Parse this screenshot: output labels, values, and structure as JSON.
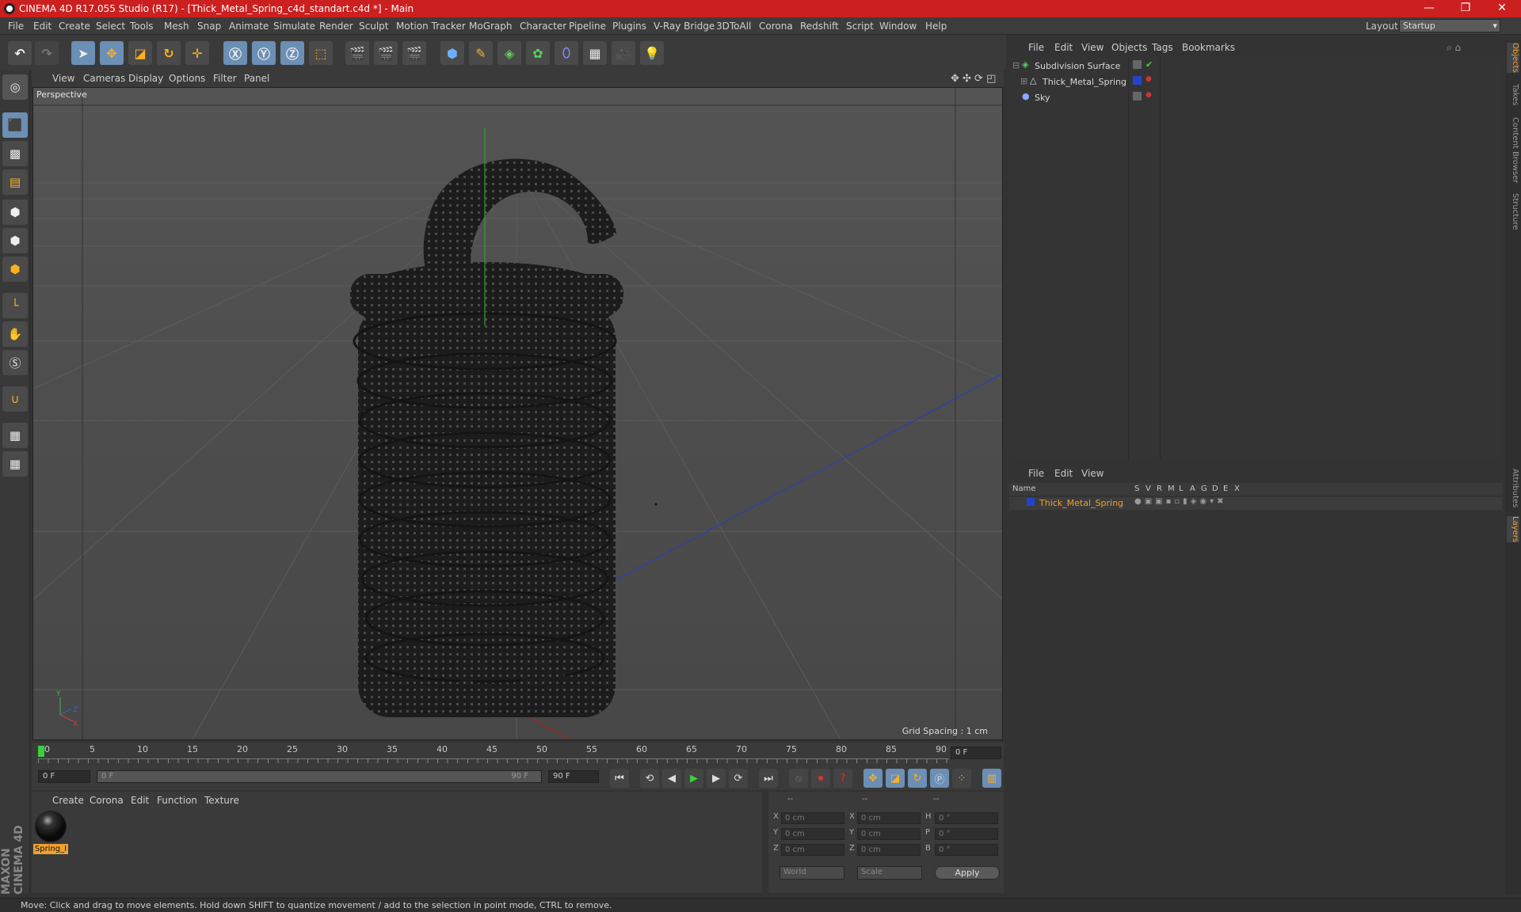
{
  "window": {
    "title": "CINEMA 4D R17.055 Studio (R17) - [Thick_Metal_Spring_c4d_standart.c4d *] - Main",
    "minimize": "—",
    "maximize": "❐",
    "close": "✕"
  },
  "menu": [
    "File",
    "Edit",
    "Create",
    "Select",
    "Tools",
    "Mesh",
    "Snap",
    "Animate",
    "Simulate",
    "Render",
    "Sculpt",
    "Motion Tracker",
    "MoGraph",
    "Character",
    "Pipeline",
    "Plugins",
    "V-Ray Bridge",
    "3DToAll",
    "Corona",
    "Redshift",
    "Script",
    "Window",
    "Help"
  ],
  "layout": {
    "label": "Layout:",
    "value": "Startup"
  },
  "viewport": {
    "menu": [
      "View",
      "Cameras",
      "Display",
      "Options",
      "Filter",
      "Panel"
    ],
    "camera": "Perspective",
    "grid_spacing": "Grid Spacing : 1 cm"
  },
  "timeline": {
    "ticks": [
      "0",
      "5",
      "10",
      "15",
      "20",
      "25",
      "30",
      "35",
      "40",
      "45",
      "50",
      "55",
      "60",
      "65",
      "70",
      "75",
      "80",
      "85",
      "90"
    ],
    "current_frame": "0 F"
  },
  "playbar": {
    "start": "0 F",
    "range_start": "0 F",
    "range_end": "90 F",
    "end": "90 F"
  },
  "materials": {
    "menu": [
      "Create",
      "Corona",
      "Edit",
      "Function",
      "Texture"
    ],
    "items": [
      {
        "name": "Spring_I"
      }
    ]
  },
  "coords": {
    "headers": [
      "--",
      "--",
      "--"
    ],
    "rows": [
      {
        "a": "X",
        "av": "0 cm",
        "b": "X",
        "bv": "0 cm",
        "c": "H",
        "cv": "0 °"
      },
      {
        "a": "Y",
        "av": "0 cm",
        "b": "Y",
        "bv": "0 cm",
        "c": "P",
        "cv": "0 °"
      },
      {
        "a": "Z",
        "av": "0 cm",
        "b": "Z",
        "bv": "0 cm",
        "c": "B",
        "cv": "0 °"
      }
    ],
    "space": "World",
    "mode": "Scale",
    "apply": "Apply"
  },
  "objects": {
    "menu": [
      "File",
      "Edit",
      "View",
      "Objects",
      "Tags",
      "Bookmarks"
    ],
    "items": [
      {
        "name": "Subdivision Surface"
      },
      {
        "name": "Thick_Metal_Spring"
      },
      {
        "name": "Sky"
      }
    ]
  },
  "layers": {
    "menu": [
      "File",
      "Edit",
      "View"
    ],
    "columns": [
      "Name",
      "S",
      "V",
      "R",
      "M",
      "L",
      "A",
      "G",
      "D",
      "E",
      "X"
    ],
    "items": [
      {
        "name": "Thick_Metal_Spring"
      }
    ]
  },
  "side_tabs": [
    "Objects",
    "Takes",
    "Content Browser",
    "Structure",
    "Attributes",
    "Layers"
  ],
  "status": "Move: Click and drag to move elements. Hold down SHIFT to quantize movement / add to the selection in point mode, CTRL to remove.",
  "brand": "MAXON CINEMA 4D",
  "colors": {
    "accent": "#cc1f1f",
    "layer_name": "#f0a030",
    "blue_tag": "#2244cc"
  }
}
